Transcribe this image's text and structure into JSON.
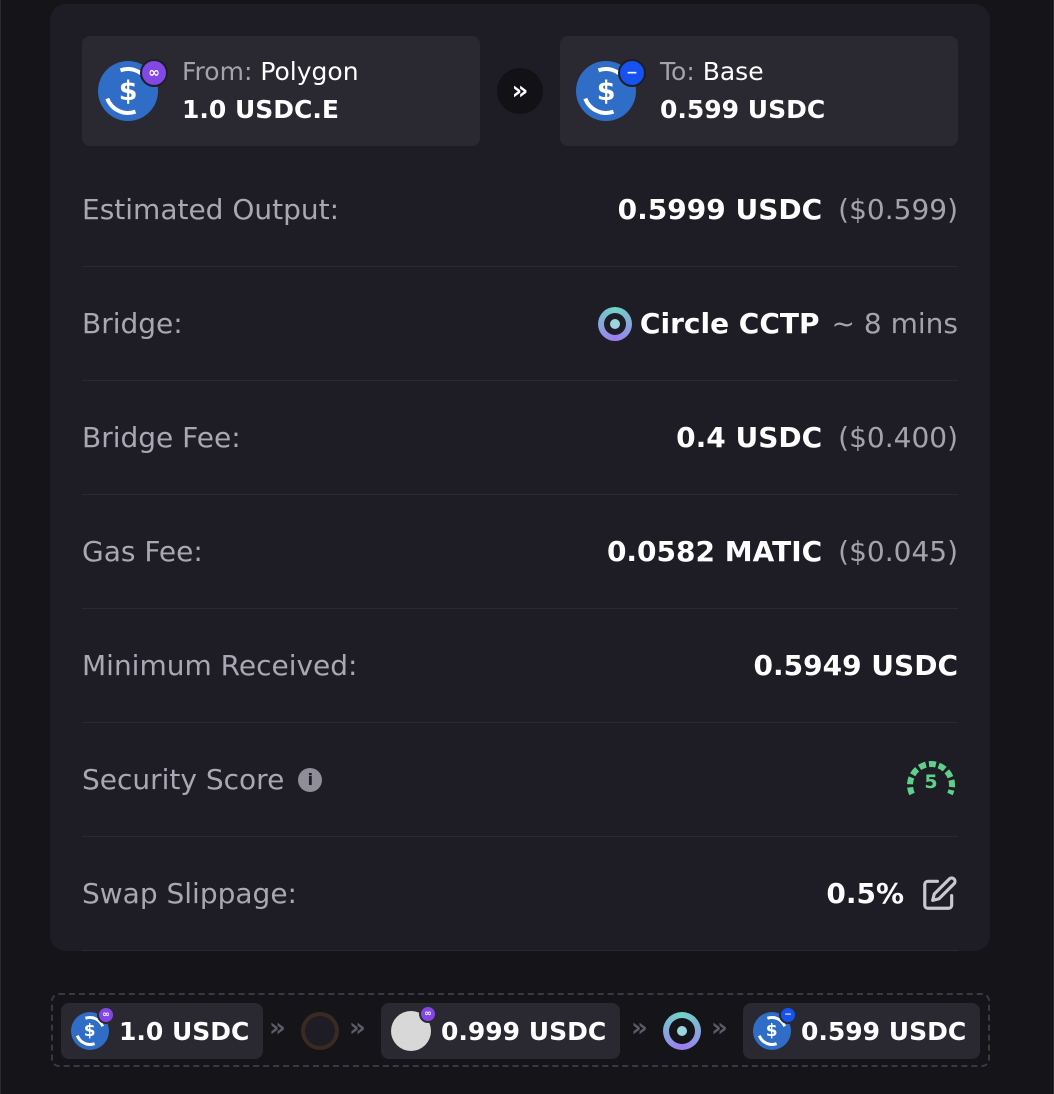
{
  "from": {
    "label": "From:",
    "chain": "Polygon",
    "amount": "1.0 USDC.E"
  },
  "to": {
    "label": "To:",
    "chain": "Base",
    "amount": "0.599 USDC"
  },
  "details": {
    "estimated_output": {
      "label": "Estimated Output:",
      "value": "0.5999 USDC",
      "usd": "($0.599)"
    },
    "bridge": {
      "label": "Bridge:",
      "name": "Circle CCTP",
      "time": "~ 8 mins"
    },
    "bridge_fee": {
      "label": "Bridge Fee:",
      "value": "0.4 USDC",
      "usd": "($0.400)"
    },
    "gas_fee": {
      "label": "Gas Fee:",
      "value": "0.0582 MATIC",
      "usd": "($0.045)"
    },
    "minimum_received": {
      "label": "Minimum Received:",
      "value": "0.5949 USDC"
    },
    "security_score": {
      "label": "Security Score",
      "value": "5"
    },
    "swap_slippage": {
      "label": "Swap Slippage:",
      "value": "0.5%"
    }
  },
  "route": {
    "step1": "1.0 USDC",
    "step2": "0.999 USDC",
    "step3": "0.599 USDC"
  },
  "colors": {
    "background": "#151419",
    "card": "#1e1d25",
    "panel": "#2a2932",
    "usdc_blue": "#2f6dc6",
    "polygon_purple": "#8247e5",
    "base_blue": "#1652f0",
    "score_green": "#5fd08a"
  },
  "icons": {
    "coin": "usdc-coin-icon",
    "polygon_badge": "polygon-icon",
    "base_badge": "base-icon",
    "bridge": "circle-cctp-icon",
    "info": "info-icon",
    "edit": "edit-icon",
    "arrow": "double-chevron-right-icon"
  }
}
